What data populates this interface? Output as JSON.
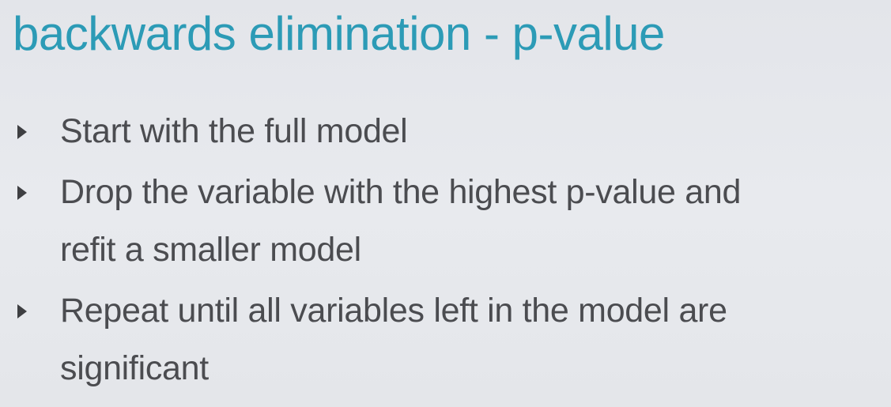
{
  "slide": {
    "title": "backwards elimination - p-value",
    "bullets": [
      {
        "line1": "Start with the full model",
        "line2": ""
      },
      {
        "line1": "Drop the variable with the highest p-value and",
        "line2": "refit a smaller model"
      },
      {
        "line1": "Repeat until all variables left in the model are",
        "line2": "significant"
      }
    ]
  },
  "colors": {
    "title": "#2c9bb6",
    "text": "#4b4c50",
    "background": "#e6e8ec"
  }
}
